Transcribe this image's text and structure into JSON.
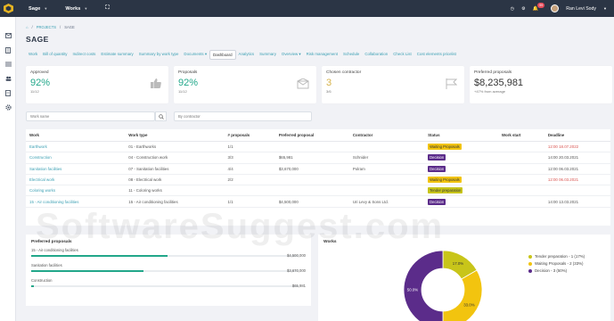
{
  "topbar": {
    "menus": [
      {
        "label": "Sage"
      },
      {
        "label": "Works"
      }
    ],
    "notification_count": "99",
    "user_name": "Ran Levi Sody"
  },
  "breadcrumb": {
    "items": [
      "PROJECTS",
      "SAGE"
    ]
  },
  "page_title": "SAGE",
  "tabs": [
    "Work",
    "Bill of quantity",
    "Indirect costs",
    "Estimate summary",
    "Summary by work type",
    "Documents ▾",
    "Dashboard",
    "Analytics",
    "Summary",
    "Overview ▾",
    "Risk management",
    "Schedule",
    "Collaboration",
    "Check List",
    "Cost elements pricelist"
  ],
  "active_tab": "Dashboard",
  "cards": [
    {
      "label": "Approved",
      "value": "92%",
      "sub": "11/12",
      "value_color": "#22a78a",
      "icon": "thumbs-up-icon"
    },
    {
      "label": "Proposals",
      "value": "92%",
      "sub": "11/12",
      "value_color": "#22a78a",
      "icon": "envelope-icon"
    },
    {
      "label": "Chosen contractor",
      "value": "3",
      "sub": "3/6",
      "value_color": "#d6b24a",
      "icon": "flag-icon"
    },
    {
      "label": "Preferred proposals",
      "value": "$8,235,981",
      "sub": "+47% from average",
      "value_color": "#333333",
      "icon": ""
    }
  ],
  "filters": {
    "work_placeholder": "Work name",
    "contractor_placeholder": "By contractor"
  },
  "table": {
    "headers": [
      "Work",
      "Work type",
      "# proposals",
      "Preferred proposal",
      "Contractor",
      "Status",
      "Work start",
      "Deadline"
    ],
    "rows": [
      {
        "work": "Earthwork",
        "type": "01 - Earthworks",
        "proposals": "1/1",
        "preferred": "",
        "contractor": "",
        "status": "Waiting Proposals",
        "status_kind": "wait",
        "start": "",
        "deadline": "12:00 18.07.2022",
        "deadline_red": true
      },
      {
        "work": "Construction",
        "type": "04 - Construction work",
        "proposals": "3/3",
        "preferred": "$65,981",
        "contractor": "Schnider",
        "status": "Decision",
        "status_kind": "dec",
        "start": "",
        "deadline": "14:00 20.03.2021",
        "deadline_red": false
      },
      {
        "work": "Sanitation facilities",
        "type": "07 - Sanitation facilities",
        "proposals": "4/4",
        "preferred": "$3,670,000",
        "contractor": "Polram",
        "status": "Decision",
        "status_kind": "dec",
        "start": "",
        "deadline": "12:00 06.03.2021",
        "deadline_red": false
      },
      {
        "work": "Electrical work",
        "type": "08 - Electrical work",
        "proposals": "2/2",
        "preferred": "",
        "contractor": "",
        "status": "Waiting Proposals",
        "status_kind": "wait",
        "start": "",
        "deadline": "12:00 06.03.2021",
        "deadline_red": true
      },
      {
        "work": "Coloring works",
        "type": "11 - Coloring works",
        "proposals": "",
        "preferred": "",
        "contractor": "",
        "status": "Tender preparation",
        "status_kind": "tend",
        "start": "",
        "deadline": "",
        "deadline_red": false
      },
      {
        "work": "15 - Air conditioning facilities",
        "type": "15 - Air conditioning facilities",
        "proposals": "1/1",
        "preferred": "$4,500,000",
        "contractor": "Uri Levy & Sons Ltd.",
        "status": "Decision",
        "status_kind": "dec",
        "start": "",
        "deadline": "14:00 13.03.2021",
        "deadline_red": false
      }
    ]
  },
  "preferred_proposals": {
    "title": "Preferred proposals",
    "items": [
      {
        "name": "15 - Air conditioning facilities",
        "value": "$4,500,000",
        "fill": 0.51
      },
      {
        "name": "Sanitation facilities",
        "value": "$3,670,000",
        "fill": 0.42
      },
      {
        "name": "Construction",
        "value": "$65,981",
        "fill": 0.01
      }
    ]
  },
  "works_chart": {
    "title": "Works",
    "legend": [
      {
        "label": "Tender preparation - 1 (17%)",
        "color": "#c8c51a"
      },
      {
        "label": "Waiting Proposals - 2 (33%)",
        "color": "#f2c40f"
      },
      {
        "label": "Decision - 3 (50%)",
        "color": "#5b2c8a"
      }
    ]
  },
  "chart_data": {
    "type": "pie",
    "title": "Works",
    "categories": [
      "Tender preparation",
      "Waiting Proposals",
      "Decision"
    ],
    "values": [
      1,
      2,
      3
    ],
    "labels": [
      "17.0%",
      "33.0%",
      "50.0%"
    ],
    "colors": [
      "#c8c51a",
      "#f2c40f",
      "#5b2c8a"
    ],
    "legend": "right"
  },
  "watermark": "SoftwareSuggest.com"
}
